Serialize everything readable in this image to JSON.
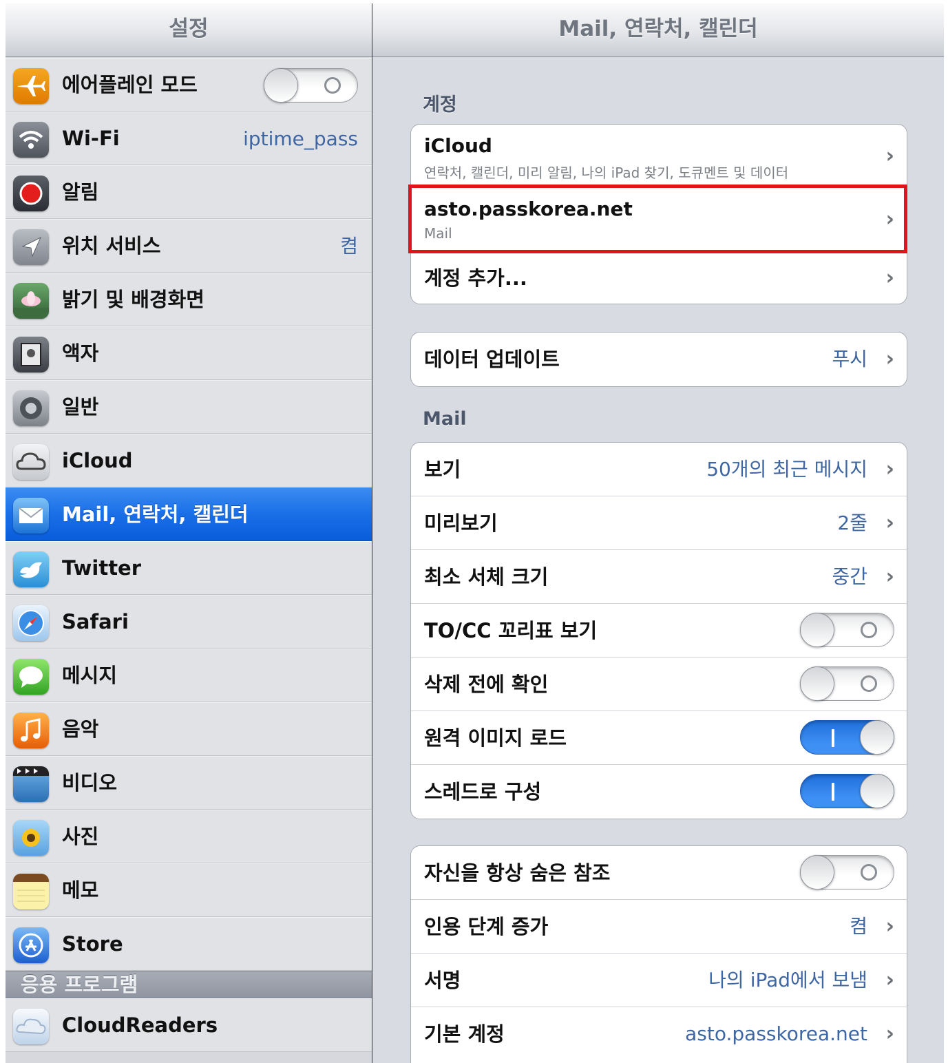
{
  "sidebar": {
    "title": "설정",
    "items": [
      {
        "label": "에어플레인 모드",
        "icon": "airplane-icon",
        "switch": "off"
      },
      {
        "label": "Wi-Fi",
        "value": "iptime_pass",
        "icon": "wifi-icon"
      },
      {
        "label": "알림",
        "icon": "notifications-icon"
      },
      {
        "label": "위치 서비스",
        "value": "켬",
        "icon": "location-icon"
      },
      {
        "label": "밝기 및 배경화면",
        "icon": "wallpaper-icon"
      },
      {
        "label": "액자",
        "icon": "picture-frame-icon"
      },
      {
        "label": "일반",
        "icon": "gear-icon"
      },
      {
        "label": "iCloud",
        "icon": "icloud-icon"
      },
      {
        "label": "Mail, 연락처, 캘린더",
        "icon": "mail-icon",
        "selected": true
      },
      {
        "label": "Twitter",
        "icon": "twitter-icon"
      },
      {
        "label": "Safari",
        "icon": "safari-icon"
      },
      {
        "label": "메시지",
        "icon": "messages-icon"
      },
      {
        "label": "음악",
        "icon": "music-icon"
      },
      {
        "label": "비디오",
        "icon": "video-icon"
      },
      {
        "label": "사진",
        "icon": "photos-icon"
      },
      {
        "label": "메모",
        "icon": "notes-icon"
      },
      {
        "label": "Store",
        "icon": "app-store-icon"
      }
    ],
    "apps_section": "응용 프로그램",
    "apps": [
      {
        "label": "CloudReaders",
        "icon": "cloudreaders-icon"
      }
    ]
  },
  "detail": {
    "title": "Mail, 연락처, 캘린더",
    "accounts_header": "계정",
    "accounts": [
      {
        "title": "iCloud",
        "subtitle": "연락처, 캘린더, 미리 알림, 나의 iPad 찾기, 도큐멘트 및 데이터"
      },
      {
        "title": "asto.passkorea.net",
        "subtitle": "Mail"
      }
    ],
    "add_account": "계정 추가...",
    "fetch": {
      "label": "데이터 업데이트",
      "value": "푸시"
    },
    "mail_header": "Mail",
    "mail_rows": [
      {
        "label": "보기",
        "value": "50개의 최근 메시지"
      },
      {
        "label": "미리보기",
        "value": "2줄"
      },
      {
        "label": "최소 서체 크기",
        "value": "중간"
      },
      {
        "label": "TO/CC 꼬리표 보기",
        "switch": "off"
      },
      {
        "label": "삭제 전에 확인",
        "switch": "off"
      },
      {
        "label": "원격 이미지 로드",
        "switch": "on"
      },
      {
        "label": "스레드로 구성",
        "switch": "on"
      }
    ],
    "misc_rows": [
      {
        "label": "자신을 항상 숨은 참조",
        "switch": "off"
      },
      {
        "label": "인용 단계 증가",
        "value": "켬"
      },
      {
        "label": "서명",
        "value": "나의 iPad에서 보냄"
      },
      {
        "label": "기본 계정",
        "value": "asto.passkorea.net"
      }
    ]
  },
  "colors": {
    "accent_blue": "#1a6fe7",
    "value_blue": "#3e66a3",
    "highlight_red": "#e0141b"
  }
}
